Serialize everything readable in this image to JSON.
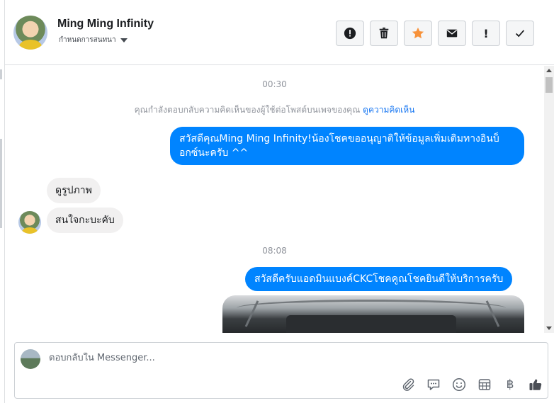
{
  "header": {
    "name": "Ming Ming Infinity",
    "subtitle": "กำหนดการสนทนา",
    "toolbar": [
      {
        "icon": "alert-circle-icon"
      },
      {
        "icon": "trash-icon"
      },
      {
        "icon": "star-icon",
        "color": "#f7923a"
      },
      {
        "icon": "mail-icon"
      },
      {
        "icon": "exclamation-icon",
        "label": "!"
      },
      {
        "icon": "check-icon"
      }
    ]
  },
  "conversation": {
    "stamp1": "00:30",
    "notice_text": "คุณกำลังตอบกลับความคิดเห็นของผู้ใช้ต่อโพสต์บนเพจของคุณ ",
    "notice_link": "ดูความคิดเห็น",
    "msg_out_1": "สวัสดีคุณMing Ming Infinity!น้องโชคขออนุญาติให้ข้อมูลเพิ่มเติมทางอินบ็อกซ์นะครับ ^^",
    "msg_in_1": "ดูรูปภาพ",
    "msg_in_2": "สนใจกะบะคับ",
    "stamp2": "08:08",
    "msg_out_2": "สวัสดีครับแอดมินแบงค์CKCโชคคูณโชคยินดีให้บริการครับ",
    "out_color": "#0084ff"
  },
  "composer": {
    "placeholder": "ตอบกลับใน Messenger...",
    "tools": [
      "paperclip-icon",
      "chat-bubble-icon",
      "emoji-icon",
      "table-icon",
      "baht-icon",
      "thumbs-up-icon"
    ],
    "baht_symbol": "฿"
  }
}
